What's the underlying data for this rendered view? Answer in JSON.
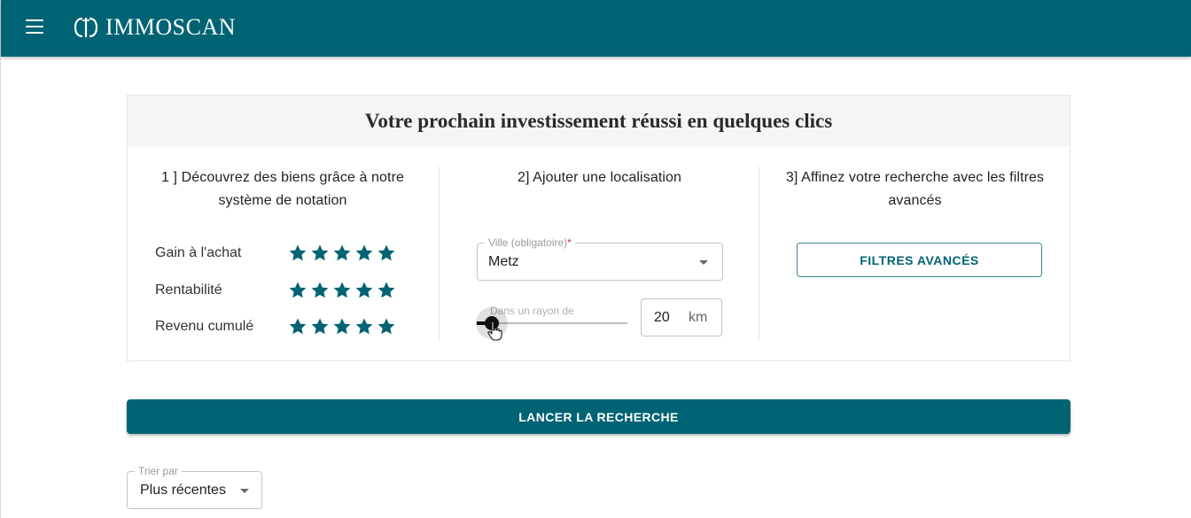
{
  "app": {
    "brand": "IMMOSCAN",
    "brand_color": "#006374",
    "menu_icon": "menu-icon",
    "logo_icon": "logo-mark-icon"
  },
  "hero": {
    "title": "Votre prochain investissement réussi en quelques clics"
  },
  "step1": {
    "title_line1": "1 ] Découvrez des biens grâce à notre",
    "title_line2": "système de notation",
    "ratings": [
      {
        "label": "Gain à l'achat",
        "stars": 5
      },
      {
        "label": "Rentabilité",
        "stars": 5
      },
      {
        "label": "Revenu cumulé",
        "stars": 5
      }
    ]
  },
  "step2": {
    "title": "2] Ajouter une localisation",
    "city": {
      "label": "Ville (obligatoire)",
      "required_mark": "*",
      "value": "Metz"
    },
    "radius": {
      "label": "Dans un rayon de",
      "value": "20",
      "unit": "km",
      "slider_fraction": 0.1
    }
  },
  "step3": {
    "title_line1": "3] Affinez votre recherche avec les filtres",
    "title_line2": "avancés",
    "button_label": "FILTRES AVANCÉS"
  },
  "search": {
    "button_label": "LANCER LA RECHERCHE"
  },
  "sort": {
    "label": "Trier par",
    "value": "Plus récentes"
  }
}
